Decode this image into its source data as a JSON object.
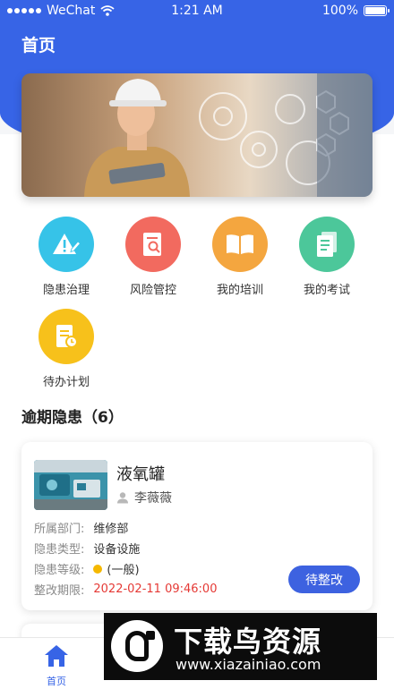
{
  "status_bar": {
    "carrier": "WeChat",
    "time": "1:21 AM",
    "battery": "100%"
  },
  "header": {
    "title": "首页"
  },
  "banner": {
    "image_icon": "engineer-with-gears-banner"
  },
  "menu_grid": [
    {
      "label": "隐患治理",
      "icon": "warning-edit-icon",
      "color": "#36c3e8"
    },
    {
      "label": "风险管控",
      "icon": "document-search-icon",
      "color": "#f26a5f"
    },
    {
      "label": "我的培训",
      "icon": "open-book-icon",
      "color": "#f4a63f"
    },
    {
      "label": "我的考试",
      "icon": "exam-paper-icon",
      "color": "#4cc79a"
    },
    {
      "label": "待办计划",
      "icon": "plan-clock-icon",
      "color": "#f7c11b"
    }
  ],
  "overdue_section": {
    "title": "逾期隐患（6）"
  },
  "hazard_card": {
    "name": "液氧罐",
    "person": "李薇薇",
    "rows": [
      {
        "key": "所属部门:",
        "value": "维修部"
      },
      {
        "key": "隐患类型:",
        "value": "设备设施"
      },
      {
        "key": "隐患等级:",
        "value": "(一般)"
      },
      {
        "key": "整改期限:",
        "value": "2022-02-11 09:46:00"
      }
    ],
    "level_color": "#f5b800",
    "action_label": "待整改"
  },
  "tabbar": [
    {
      "label": "首页",
      "icon": "home-icon",
      "active": true
    },
    {
      "label": "",
      "icon": "tab-2-icon",
      "active": false
    },
    {
      "label": "",
      "icon": "tab-3-icon",
      "active": false
    },
    {
      "label": "",
      "icon": "tab-4-icon",
      "active": false
    },
    {
      "label": "",
      "icon": "tab-5-icon",
      "active": false
    }
  ],
  "watermark": {
    "title": "下载鸟资源",
    "url": "www.xiazainiao.com"
  },
  "colors": {
    "primary": "#3764e6",
    "deadline": "#e53935",
    "button": "#3d62e0"
  }
}
